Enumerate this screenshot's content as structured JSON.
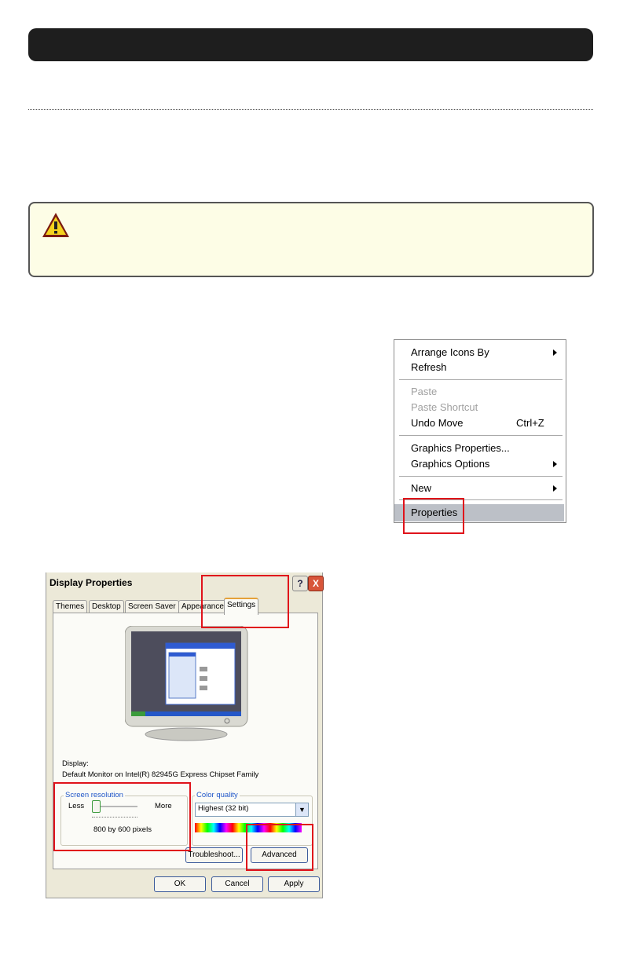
{
  "header": {
    "title": ""
  },
  "warning": {
    "icon": "warning-triangle-icon",
    "text": ""
  },
  "context_menu": {
    "items": [
      {
        "label": "Arrange Icons By",
        "submenu": true
      },
      {
        "label": "Refresh"
      },
      {
        "label": "Paste",
        "disabled": true
      },
      {
        "label": "Paste Shortcut",
        "disabled": true
      },
      {
        "label": "Undo Move",
        "shortcut": "Ctrl+Z"
      },
      {
        "label": "Graphics Properties..."
      },
      {
        "label": "Graphics Options",
        "submenu": true
      },
      {
        "label": "New",
        "submenu": true
      },
      {
        "label": "Properties",
        "highlighted": true
      }
    ]
  },
  "dialog": {
    "title": "Display Properties",
    "help_label": "?",
    "close_label": "X",
    "tabs": [
      "Themes",
      "Desktop",
      "Screen Saver",
      "Appearance",
      "Settings"
    ],
    "active_tab": "Settings",
    "display_label": "Display:",
    "display_value": "Default Monitor on Intel(R) 82945G Express Chipset Family",
    "screen_resolution": {
      "label": "Screen resolution",
      "less": "Less",
      "more": "More",
      "value_text": "800 by 600 pixels",
      "slider_level": 0
    },
    "color_quality": {
      "label": "Color quality",
      "selected": "Highest (32 bit)"
    },
    "buttons": {
      "troubleshoot": "Troubleshoot...",
      "advanced": "Advanced",
      "ok": "OK",
      "cancel": "Cancel",
      "apply": "Apply"
    }
  },
  "colors": {
    "highlight_box": "#e0131b",
    "warning_bg": "#fdfde6",
    "header_bar": "#1e1e1e"
  }
}
